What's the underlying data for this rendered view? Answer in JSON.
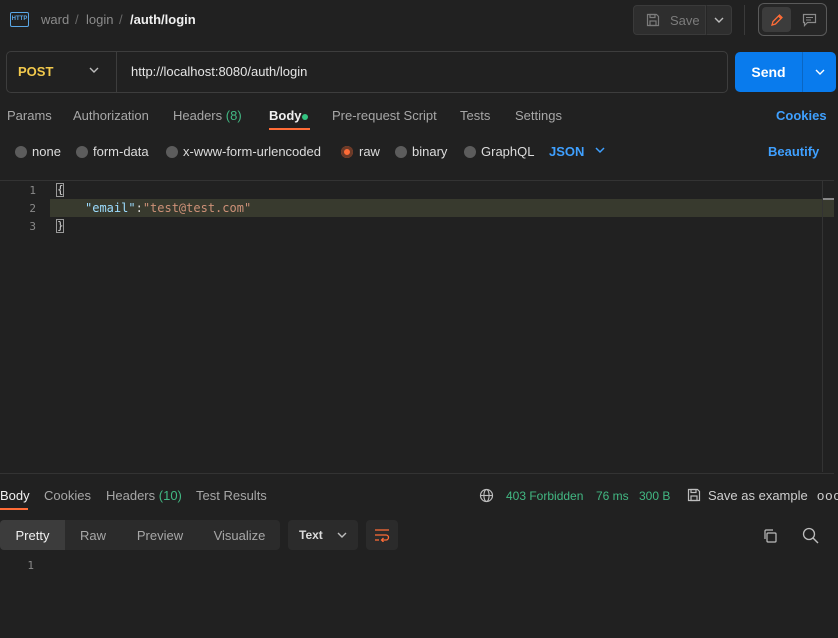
{
  "breadcrumb": {
    "icon_text": "HTTP",
    "part1": "ward",
    "part2": "login",
    "current": "/auth/login",
    "sep": "/"
  },
  "toolbar": {
    "save_label": "Save"
  },
  "request": {
    "method": "POST",
    "url": "http://localhost:8080/auth/login",
    "send_label": "Send"
  },
  "tabs": {
    "params": "Params",
    "authorization": "Authorization",
    "headers": "Headers",
    "headers_count": "(8)",
    "body": "Body",
    "prerequest": "Pre-request Script",
    "tests": "Tests",
    "settings": "Settings",
    "cookies": "Cookies"
  },
  "body_types": {
    "none": "none",
    "form_data": "form-data",
    "urlencoded": "x-www-form-urlencoded",
    "raw": "raw",
    "binary": "binary",
    "graphql": "GraphQL",
    "selected": "raw",
    "language": "JSON",
    "beautify": "Beautify"
  },
  "editor": {
    "line_numbers": [
      "1",
      "2",
      "3"
    ],
    "open_brace": "{",
    "key": "\"email\"",
    "colon": ":",
    "value": "\"test@test.com\"",
    "close_brace": "}"
  },
  "response": {
    "tabs": {
      "body": "Body",
      "cookies": "Cookies",
      "headers": "Headers",
      "headers_count": "(10)",
      "test_results": "Test Results"
    },
    "status": "403 Forbidden",
    "time": "76 ms",
    "size": "300 B",
    "save_example": "Save as example",
    "more": "ooo",
    "formats": {
      "pretty": "Pretty",
      "raw": "Raw",
      "preview": "Preview",
      "visualize": "Visualize"
    },
    "text_type": "Text",
    "line_number": "1"
  },
  "colors": {
    "accent": "#ff6c37",
    "send": "#097bed",
    "link": "#3fa0ff",
    "status_ok": "#42b883",
    "method": "#f2c94c"
  }
}
